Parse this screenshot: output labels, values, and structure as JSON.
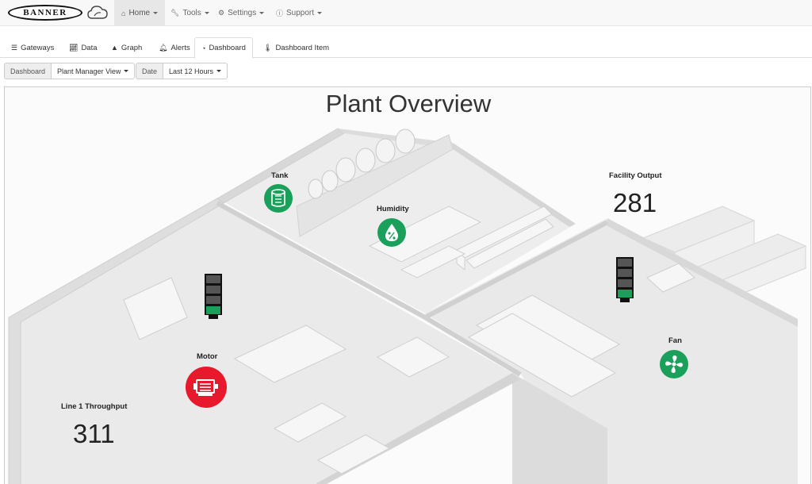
{
  "brand": {
    "logo_text": "BANNER"
  },
  "topnav": {
    "items": [
      {
        "label": "Home",
        "icon": "home-icon"
      },
      {
        "label": "Tools",
        "icon": "wrench-icon"
      },
      {
        "label": "Settings",
        "icon": "cogs-icon"
      },
      {
        "label": "Support",
        "icon": "info-icon"
      }
    ]
  },
  "tabs": [
    {
      "label": "Gateways",
      "icon": "list-icon"
    },
    {
      "label": "Data",
      "icon": "line-chart-icon"
    },
    {
      "label": "Graph",
      "icon": "area-chart-icon"
    },
    {
      "label": "Alerts",
      "icon": "bell-icon"
    },
    {
      "label": "Dashboard",
      "icon": "dashboard-icon"
    },
    {
      "label": "Dashboard Item",
      "icon": "thermometer-icon"
    }
  ],
  "filters": {
    "dashboard_label": "Dashboard",
    "dashboard_value": "Plant Manager View",
    "date_label": "Date",
    "date_value": "Last 12 Hours"
  },
  "dashboard": {
    "title": "Plant Overview",
    "widgets": {
      "tank": {
        "label": "Tank",
        "status_color": "#1aa05a",
        "icon": "tank-icon"
      },
      "humidity": {
        "label": "Humidity",
        "status_color": "#1aa05a",
        "icon": "humidity-drop-icon"
      },
      "facility_output": {
        "label": "Facility Output",
        "value": "281"
      },
      "motor": {
        "label": "Motor",
        "status_color": "#e8192c",
        "icon": "motor-icon"
      },
      "fan": {
        "label": "Fan",
        "status_color": "#1aa05a",
        "icon": "fan-icon"
      },
      "line1": {
        "label": "Line 1 Throughput",
        "value": "311"
      },
      "stack_light_left": {
        "lit_segment": 4,
        "segments": 4,
        "color": "#1aa05a"
      },
      "stack_light_right": {
        "lit_segment": 4,
        "segments": 4,
        "color": "#1aa05a"
      }
    }
  }
}
